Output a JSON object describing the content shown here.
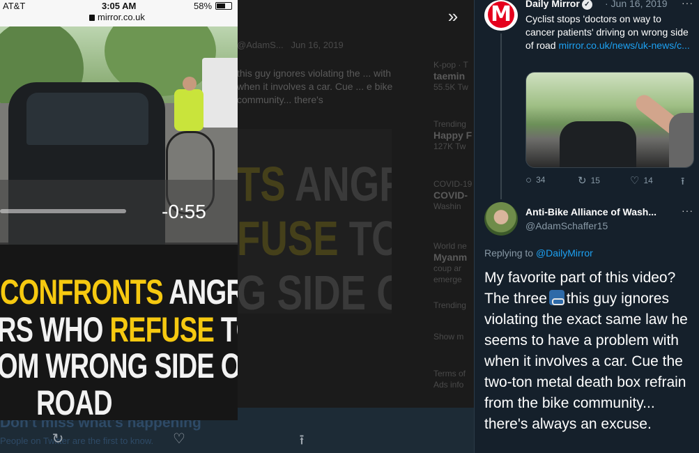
{
  "background": {
    "tweet_handle": "@AdamS...",
    "tweet_date": "Jun 16, 2019",
    "tweet_text": "this guy ignores violating the ... with when it involves a car. Cue ... e bike community... there's",
    "trends": [
      {
        "category": "K-pop · T",
        "name": "taemin",
        "count": "55.5K Tw"
      },
      {
        "category": "Trending",
        "name": "Happy F",
        "count": "127K Tw"
      },
      {
        "category": "COVID-19",
        "name": "COVID-",
        "count": "Washin"
      },
      {
        "category": "World ne",
        "name": "Myanm",
        "count": "coup ar emerge"
      },
      {
        "category": "Trending",
        "name": "",
        "count": ""
      },
      {
        "category": "Show m",
        "name": "",
        "count": ""
      },
      {
        "category": "Terms of",
        "name": "Ads info",
        "count": ""
      }
    ],
    "banner_title": "Don't miss what's happening",
    "banner_sub": "People on Twitter are the first to know."
  },
  "phone": {
    "carrier": "AT&T",
    "time": "3:05 AM",
    "battery": "58%",
    "battery_level": 0.58,
    "url": "mirror.co.uk",
    "video_remaining": "-0:55",
    "video_progress": 0.53,
    "headline": {
      "line1_yellow": "CONFRONTS",
      "line1_white": " ANGR",
      "line2_white_a": "RS WHO ",
      "line2_yellow": "REFUSE",
      "line2_white_b": " TO",
      "line3": "OM WRONG SIDE O",
      "line4": "ROAD"
    }
  },
  "column": {
    "expand_icon": "»",
    "original": {
      "avatar_letter": "M",
      "name": "Daily Mirror",
      "verified": "✓",
      "date": "· Jun 16, 2019",
      "more": "···",
      "text": "Cyclist stops 'doctors on way to cancer patients' driving on wrong side of road ",
      "link": "mirror.co.uk/news/uk-news/c...",
      "replies": "34",
      "retweets": "15",
      "likes": "14"
    },
    "reply": {
      "name": "Anti-Bike Alliance of Wash...",
      "handle": "@AdamSchaffer15",
      "more": "···",
      "replying_label": "Replying to ",
      "replying_to": "@DailyMirror",
      "text_before": "My favorite part of this video? The three",
      "text_after": "this guy ignores violating the exact same law he seems to have a problem with when it involves a car. Cue the two-ton metal death box refrain from the bike community... there's always an excuse."
    }
  },
  "colors": {
    "accent": "#1da1f2",
    "background": "#15202b",
    "headline_yellow": "#f6c910",
    "mirror_red": "#e5001c"
  }
}
